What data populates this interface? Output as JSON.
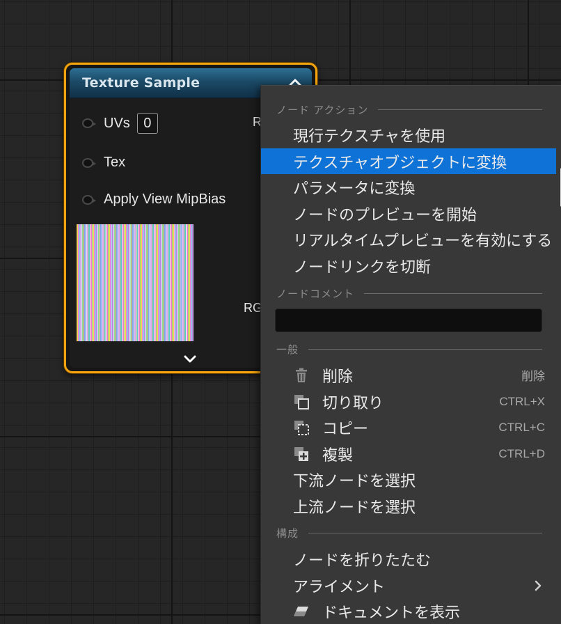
{
  "node": {
    "title": "Texture Sample",
    "pins": {
      "uvs_label": "UVs",
      "uvs_value": "0",
      "tex_label": "Tex",
      "mip_label": "Apply View MipBias"
    },
    "outputs": {
      "rgb_top": "R",
      "rgb_bottom": "RG"
    },
    "icons": {
      "collapse": "chevron-up-icon",
      "expand": "chevron-down-icon",
      "pin": "pin-circle-icon"
    },
    "colors": {
      "border": "#f2a30f",
      "header": "#1b4a66"
    }
  },
  "menu": {
    "sections": {
      "node_actions": "ノード アクション",
      "node_comment": "ノードコメント",
      "general": "一般",
      "structure": "構成"
    },
    "node_actions": [
      "現行テクスチャを使用",
      "テクスチャオブジェクトに変換",
      "パラメータに変換",
      "ノードのプレビューを開始",
      "リアルタイムプレビューを有効にする",
      "ノードリンクを切断"
    ],
    "comment_value": "",
    "general": [
      {
        "label": "削除",
        "shortcut": "削除",
        "icon": "trash-icon"
      },
      {
        "label": "切り取り",
        "shortcut": "CTRL+X",
        "icon": "cut-icon"
      },
      {
        "label": "コピー",
        "shortcut": "CTRL+C",
        "icon": "copy-icon"
      },
      {
        "label": "複製",
        "shortcut": "CTRL+D",
        "icon": "duplicate-icon"
      }
    ],
    "select": [
      "下流ノードを選択",
      "上流ノードを選択"
    ],
    "structure": [
      {
        "label": "ノードを折りたたむ"
      },
      {
        "label": "アライメント",
        "icon": "chevron-right-icon"
      },
      {
        "label": "ドキュメントを表示",
        "icon": "eraser-icon"
      }
    ],
    "highlight_color": "#0f72d6"
  }
}
